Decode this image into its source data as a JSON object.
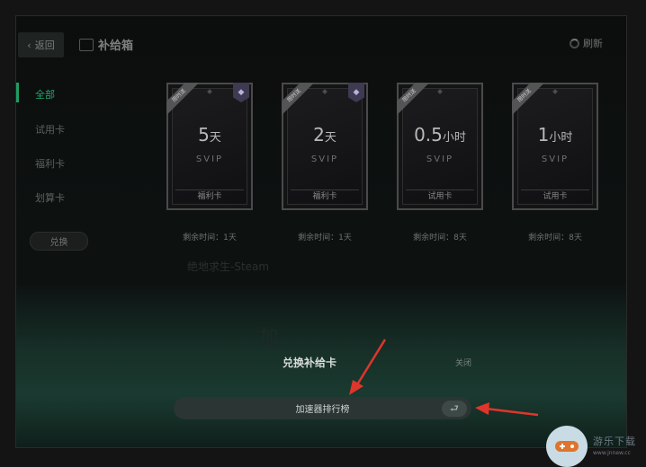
{
  "header": {
    "back_label": "返回",
    "title": "补给箱",
    "refresh_label": "刷新"
  },
  "sidebar": {
    "items": [
      {
        "label": "全部",
        "active": true
      },
      {
        "label": "试用卡",
        "active": false
      },
      {
        "label": "福利卡",
        "active": false
      },
      {
        "label": "划算卡",
        "active": false
      }
    ],
    "redeem_label": "兑换"
  },
  "cards": [
    {
      "ribbon": "限时送",
      "amount": "5",
      "unit": "天",
      "tier": "SVIP",
      "type": "福利卡",
      "remaining": "剩余时间：1天",
      "has_badge": true
    },
    {
      "ribbon": "限时送",
      "amount": "2",
      "unit": "天",
      "tier": "SVIP",
      "type": "福利卡",
      "remaining": "剩余时间：1天",
      "has_badge": true
    },
    {
      "ribbon": "限时送",
      "amount": "0.5",
      "unit": "小时",
      "tier": "SVIP",
      "type": "试用卡",
      "remaining": "剩余时间：8天",
      "has_badge": false
    },
    {
      "ribbon": "限时送",
      "amount": "1",
      "unit": "小时",
      "tier": "SVIP",
      "type": "试用卡",
      "remaining": "剩余时间：8天",
      "has_badge": false
    }
  ],
  "background_hints": {
    "text1": "绝地求生-Steam",
    "text2": "加"
  },
  "modal": {
    "title": "兑换补给卡",
    "close_label": "关闭",
    "rank_button_label": "加速器排行榜",
    "enter_icon": "return-enter-icon"
  },
  "watermark": {
    "text": "游乐下载",
    "url": "www.jnnew.cc"
  },
  "colors": {
    "accent": "#1fa76b",
    "arrow": "#e0352b"
  }
}
